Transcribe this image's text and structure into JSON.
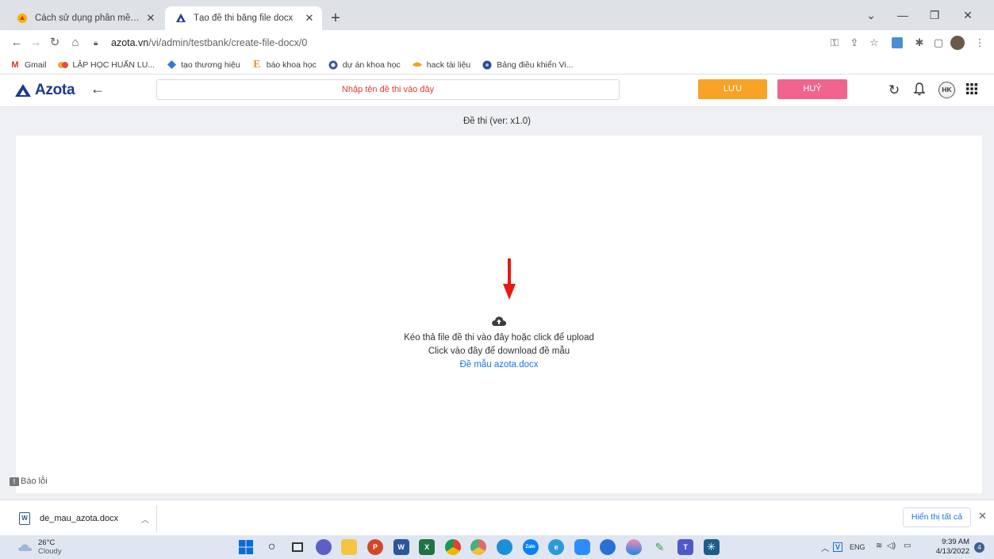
{
  "browser": {
    "tabs": [
      {
        "title": "Cách sử dụng phần mềm Azota l",
        "active": false
      },
      {
        "title": "Tạo đề thi bằng file docx",
        "active": true
      }
    ],
    "url_host": "azota.vn",
    "url_path": "/vi/admin/testbank/create-file-docx/0",
    "bookmarks": [
      {
        "label": "Gmail",
        "icon": "gmail-icon"
      },
      {
        "label": "LẬP HỌC HUẤN LU...",
        "icon": "class-icon"
      },
      {
        "label": "tạo thương hiệu",
        "icon": "brand-icon"
      },
      {
        "label": "báo khoa học",
        "icon": "e-icon"
      },
      {
        "label": "dự án khoa học",
        "icon": "globe-icon"
      },
      {
        "label": "hack tài liệu",
        "icon": "bird-icon"
      },
      {
        "label": "Bảng điều khiển Vi...",
        "icon": "dashboard-icon"
      }
    ]
  },
  "app": {
    "logo": "Azota",
    "title_placeholder": "Nhập tên đề thi vào đây",
    "save_label": "LƯU",
    "cancel_label": "HUỶ",
    "avatar_initials": "HK",
    "colors": {
      "save": "#f7a325",
      "cancel": "#f0648f",
      "link": "#1a73e8",
      "placeholder": "#e53935"
    }
  },
  "content": {
    "version_label": "Đề thi (ver: x1.0)",
    "upload_line1": "Kéo thả file đề thi vào đây hoặc click để upload",
    "upload_line2": "Click vào đây để download đề mẫu",
    "sample_link": "Đề mẫu azota.docx",
    "report_label": "Báo lỗi"
  },
  "downloads": {
    "file_name": "de_mau_azota.docx",
    "show_all": "Hiển thị tất cả"
  },
  "taskbar": {
    "temperature": "26°C",
    "condition": "Cloudy",
    "language": "ENG",
    "time": "9:39 AM",
    "date": "4/13/2022",
    "notifications": "4"
  }
}
